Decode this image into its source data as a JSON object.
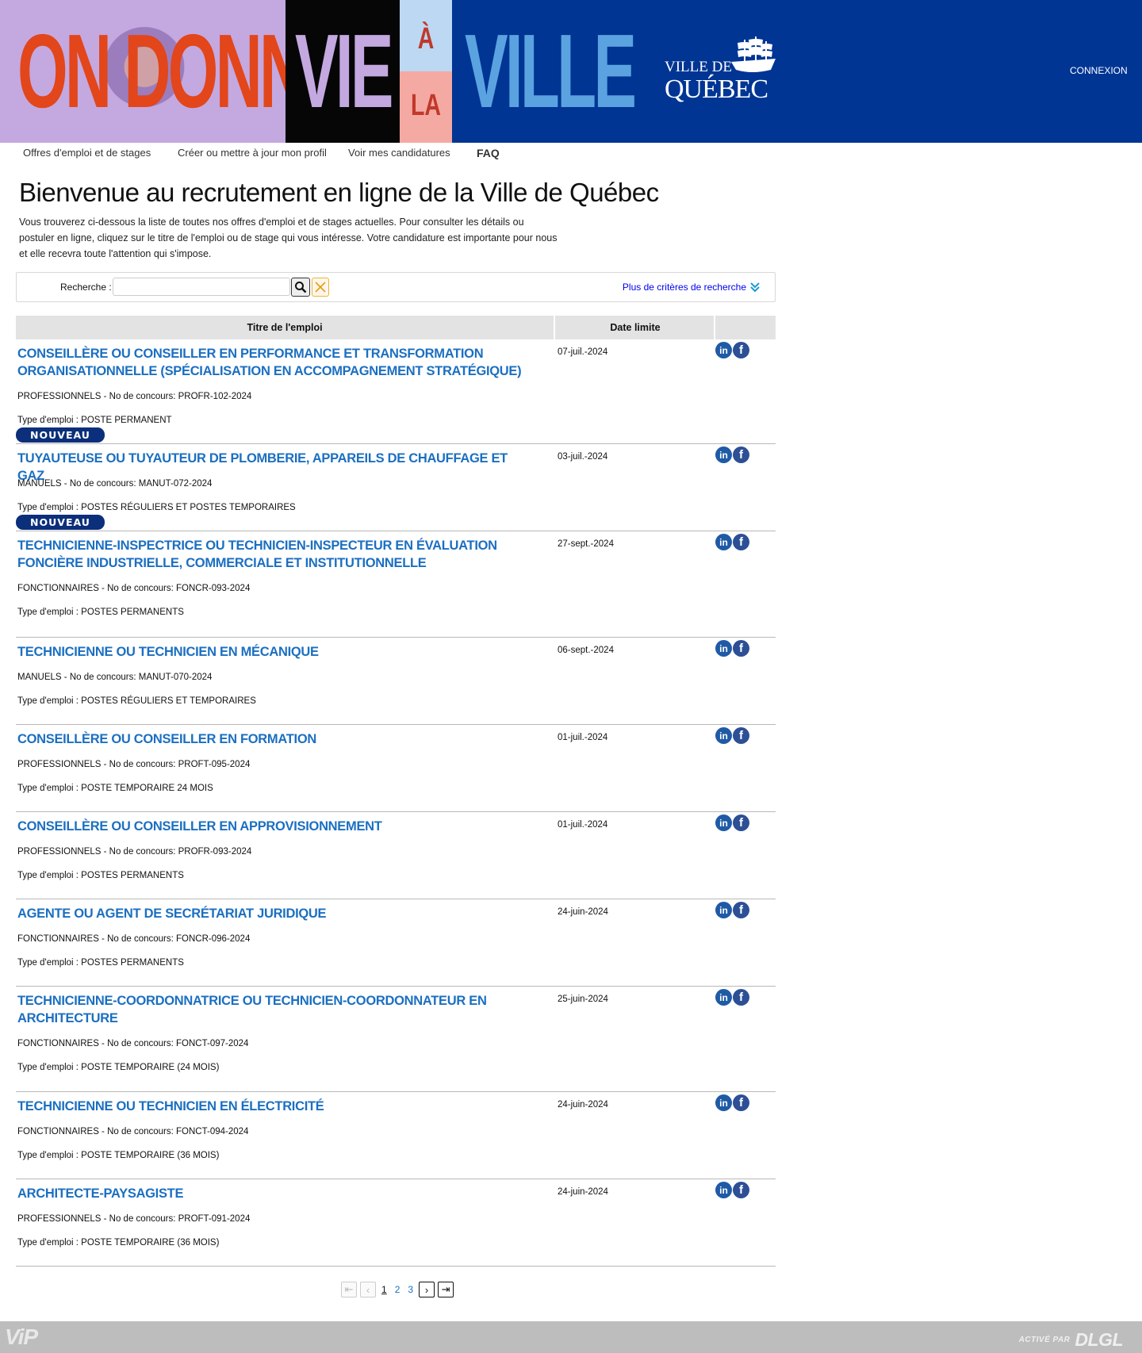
{
  "banner": {
    "word_on": "ON DONNE",
    "word_vie": "VIE",
    "word_a": "À",
    "word_la": "LA",
    "word_ville": "VILLE",
    "logo_line1": "VILLE DE",
    "logo_line2": "QUÉBEC",
    "login": "CONNEXION",
    "colors": {
      "navy": "#003594",
      "lavender": "#c4a8e0",
      "orange": "#e2461a",
      "sky": "#5aa3e0"
    }
  },
  "nav": {
    "items": [
      {
        "label": "Offres d'emploi et de stages"
      },
      {
        "label": "Créer ou mettre à jour mon profil"
      },
      {
        "label": "Voir mes candidatures"
      },
      {
        "label": "FAQ"
      }
    ]
  },
  "intro": {
    "title": "Bienvenue au recrutement en ligne de la Ville de Québec",
    "text": "Vous trouverez ci-dessous la liste de toutes nos offres d'emploi et de stages actuelles. Pour consulter les détails ou postuler en ligne, cliquez sur le titre de l'emploi ou de stage qui vous intéresse. Votre candidature est importante pour nous et elle recevra toute l'attention qui s'impose."
  },
  "search": {
    "label": "Recherche :",
    "value": "",
    "placeholder": "",
    "more_criteria": "Plus de critères de recherche",
    "icons": {
      "search": "magnifier-icon",
      "clear": "close-icon",
      "more": "double-chevron-down-icon"
    }
  },
  "table": {
    "headers": {
      "title": "Titre de l'emploi",
      "date": "Date limite"
    },
    "new_badge": "NOUVEAU",
    "rows": [
      {
        "title": "CONSEILLÈRE OU CONSEILLER EN PERFORMANCE ET TRANSFORMATION ORGANISATIONNELLE (SPÉCIALISATION EN ACCOMPAGNEMENT STRATÉGIQUE)",
        "category": "PROFESSIONNELS - No de concours: PROFR-102-2024",
        "type": "Type d'emploi : POSTE PERMANENT",
        "date": "07-juil.-2024",
        "is_new": false
      },
      {
        "title": "TUYAUTEUSE OU TUYAUTEUR DE PLOMBERIE, APPAREILS DE CHAUFFAGE ET GAZ",
        "category": "MANUELS - No de concours: MANUT-072-2024",
        "type": "Type d'emploi : POSTES RÉGULIERS ET POSTES TEMPORAIRES",
        "date": "03-juil.-2024",
        "is_new": true
      },
      {
        "title": "TECHNICIENNE-INSPECTRICE OU TECHNICIEN-INSPECTEUR EN ÉVALUATION FONCIÈRE INDUSTRIELLE, COMMERCIALE ET INSTITUTIONNELLE",
        "category": "FONCTIONNAIRES - No de concours: FONCR-093-2024",
        "type": "Type d'emploi : POSTES PERMANENTS",
        "date": "27-sept.-2024",
        "is_new": true
      },
      {
        "title": "TECHNICIENNE OU TECHNICIEN EN MÉCANIQUE",
        "category": "MANUELS - No de concours: MANUT-070-2024",
        "type": "Type d'emploi : POSTES RÉGULIERS ET TEMPORAIRES",
        "date": "06-sept.-2024",
        "is_new": false
      },
      {
        "title": "CONSEILLÈRE OU CONSEILLER EN FORMATION",
        "category": "PROFESSIONNELS - No de concours: PROFT-095-2024",
        "type": "Type d'emploi : POSTE TEMPORAIRE 24 MOIS",
        "date": "01-juil.-2024",
        "is_new": false
      },
      {
        "title": "CONSEILLÈRE OU CONSEILLER EN APPROVISIONNEMENT",
        "category": "PROFESSIONNELS - No de concours: PROFR-093-2024",
        "type": "Type d'emploi : POSTES PERMANENTS",
        "date": "01-juil.-2024",
        "is_new": false
      },
      {
        "title": "AGENTE OU AGENT DE SECRÉTARIAT JURIDIQUE",
        "category": "FONCTIONNAIRES - No de concours: FONCR-096-2024",
        "type": "Type d'emploi : POSTES PERMANENTS",
        "date": "24-juin-2024",
        "is_new": false
      },
      {
        "title": "TECHNICIENNE-COORDONNATRICE OU TECHNICIEN-COORDONNATEUR EN ARCHITECTURE",
        "category": "FONCTIONNAIRES - No de concours: FONCT-097-2024",
        "type": "Type d'emploi : POSTE TEMPORAIRE (24 MOIS)",
        "date": "25-juin-2024",
        "is_new": false
      },
      {
        "title": "TECHNICIENNE OU TECHNICIEN EN ÉLECTRICITÉ",
        "category": "FONCTIONNAIRES - No de concours: FONCT-094-2024",
        "type": "Type d'emploi : POSTE TEMPORAIRE (36 MOIS)",
        "date": "24-juin-2024",
        "is_new": false
      },
      {
        "title": "ARCHITECTE-PAYSAGISTE",
        "category": "PROFESSIONNELS - No de concours: PROFT-091-2024",
        "type": "Type d'emploi : POSTE TEMPORAIRE (36 MOIS)",
        "date": "24-juin-2024",
        "is_new": false
      }
    ]
  },
  "pager": {
    "pages": [
      "1",
      "2",
      "3"
    ],
    "current": "1"
  },
  "footer": {
    "left": "ViP",
    "right_prefix": "ACTIVÉ PAR",
    "right_brand": "DLGL"
  }
}
